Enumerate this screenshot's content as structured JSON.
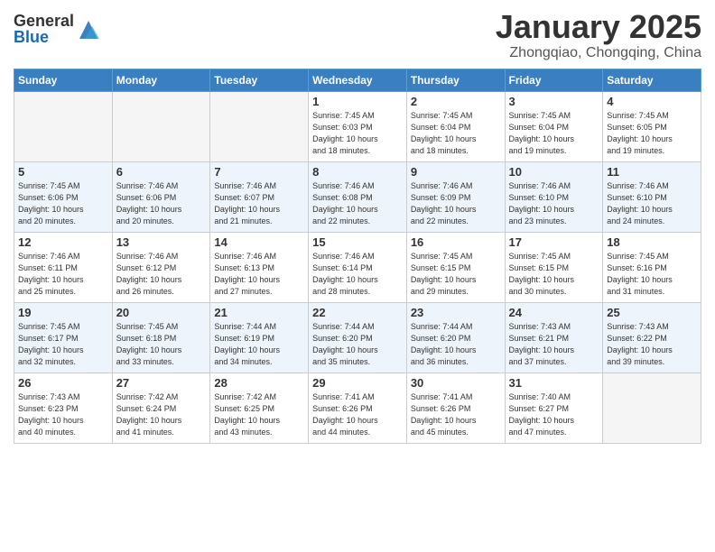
{
  "logo": {
    "general": "General",
    "blue": "Blue"
  },
  "title": "January 2025",
  "location": "Zhongqiao, Chongqing, China",
  "days_of_week": [
    "Sunday",
    "Monday",
    "Tuesday",
    "Wednesday",
    "Thursday",
    "Friday",
    "Saturday"
  ],
  "weeks": [
    {
      "alt": false,
      "days": [
        {
          "num": "",
          "info": ""
        },
        {
          "num": "",
          "info": ""
        },
        {
          "num": "",
          "info": ""
        },
        {
          "num": "1",
          "info": "Sunrise: 7:45 AM\nSunset: 6:03 PM\nDaylight: 10 hours\nand 18 minutes."
        },
        {
          "num": "2",
          "info": "Sunrise: 7:45 AM\nSunset: 6:04 PM\nDaylight: 10 hours\nand 18 minutes."
        },
        {
          "num": "3",
          "info": "Sunrise: 7:45 AM\nSunset: 6:04 PM\nDaylight: 10 hours\nand 19 minutes."
        },
        {
          "num": "4",
          "info": "Sunrise: 7:45 AM\nSunset: 6:05 PM\nDaylight: 10 hours\nand 19 minutes."
        }
      ]
    },
    {
      "alt": true,
      "days": [
        {
          "num": "5",
          "info": "Sunrise: 7:45 AM\nSunset: 6:06 PM\nDaylight: 10 hours\nand 20 minutes."
        },
        {
          "num": "6",
          "info": "Sunrise: 7:46 AM\nSunset: 6:06 PM\nDaylight: 10 hours\nand 20 minutes."
        },
        {
          "num": "7",
          "info": "Sunrise: 7:46 AM\nSunset: 6:07 PM\nDaylight: 10 hours\nand 21 minutes."
        },
        {
          "num": "8",
          "info": "Sunrise: 7:46 AM\nSunset: 6:08 PM\nDaylight: 10 hours\nand 22 minutes."
        },
        {
          "num": "9",
          "info": "Sunrise: 7:46 AM\nSunset: 6:09 PM\nDaylight: 10 hours\nand 22 minutes."
        },
        {
          "num": "10",
          "info": "Sunrise: 7:46 AM\nSunset: 6:10 PM\nDaylight: 10 hours\nand 23 minutes."
        },
        {
          "num": "11",
          "info": "Sunrise: 7:46 AM\nSunset: 6:10 PM\nDaylight: 10 hours\nand 24 minutes."
        }
      ]
    },
    {
      "alt": false,
      "days": [
        {
          "num": "12",
          "info": "Sunrise: 7:46 AM\nSunset: 6:11 PM\nDaylight: 10 hours\nand 25 minutes."
        },
        {
          "num": "13",
          "info": "Sunrise: 7:46 AM\nSunset: 6:12 PM\nDaylight: 10 hours\nand 26 minutes."
        },
        {
          "num": "14",
          "info": "Sunrise: 7:46 AM\nSunset: 6:13 PM\nDaylight: 10 hours\nand 27 minutes."
        },
        {
          "num": "15",
          "info": "Sunrise: 7:46 AM\nSunset: 6:14 PM\nDaylight: 10 hours\nand 28 minutes."
        },
        {
          "num": "16",
          "info": "Sunrise: 7:45 AM\nSunset: 6:15 PM\nDaylight: 10 hours\nand 29 minutes."
        },
        {
          "num": "17",
          "info": "Sunrise: 7:45 AM\nSunset: 6:15 PM\nDaylight: 10 hours\nand 30 minutes."
        },
        {
          "num": "18",
          "info": "Sunrise: 7:45 AM\nSunset: 6:16 PM\nDaylight: 10 hours\nand 31 minutes."
        }
      ]
    },
    {
      "alt": true,
      "days": [
        {
          "num": "19",
          "info": "Sunrise: 7:45 AM\nSunset: 6:17 PM\nDaylight: 10 hours\nand 32 minutes."
        },
        {
          "num": "20",
          "info": "Sunrise: 7:45 AM\nSunset: 6:18 PM\nDaylight: 10 hours\nand 33 minutes."
        },
        {
          "num": "21",
          "info": "Sunrise: 7:44 AM\nSunset: 6:19 PM\nDaylight: 10 hours\nand 34 minutes."
        },
        {
          "num": "22",
          "info": "Sunrise: 7:44 AM\nSunset: 6:20 PM\nDaylight: 10 hours\nand 35 minutes."
        },
        {
          "num": "23",
          "info": "Sunrise: 7:44 AM\nSunset: 6:20 PM\nDaylight: 10 hours\nand 36 minutes."
        },
        {
          "num": "24",
          "info": "Sunrise: 7:43 AM\nSunset: 6:21 PM\nDaylight: 10 hours\nand 37 minutes."
        },
        {
          "num": "25",
          "info": "Sunrise: 7:43 AM\nSunset: 6:22 PM\nDaylight: 10 hours\nand 39 minutes."
        }
      ]
    },
    {
      "alt": false,
      "days": [
        {
          "num": "26",
          "info": "Sunrise: 7:43 AM\nSunset: 6:23 PM\nDaylight: 10 hours\nand 40 minutes."
        },
        {
          "num": "27",
          "info": "Sunrise: 7:42 AM\nSunset: 6:24 PM\nDaylight: 10 hours\nand 41 minutes."
        },
        {
          "num": "28",
          "info": "Sunrise: 7:42 AM\nSunset: 6:25 PM\nDaylight: 10 hours\nand 43 minutes."
        },
        {
          "num": "29",
          "info": "Sunrise: 7:41 AM\nSunset: 6:26 PM\nDaylight: 10 hours\nand 44 minutes."
        },
        {
          "num": "30",
          "info": "Sunrise: 7:41 AM\nSunset: 6:26 PM\nDaylight: 10 hours\nand 45 minutes."
        },
        {
          "num": "31",
          "info": "Sunrise: 7:40 AM\nSunset: 6:27 PM\nDaylight: 10 hours\nand 47 minutes."
        },
        {
          "num": "",
          "info": ""
        }
      ]
    }
  ]
}
